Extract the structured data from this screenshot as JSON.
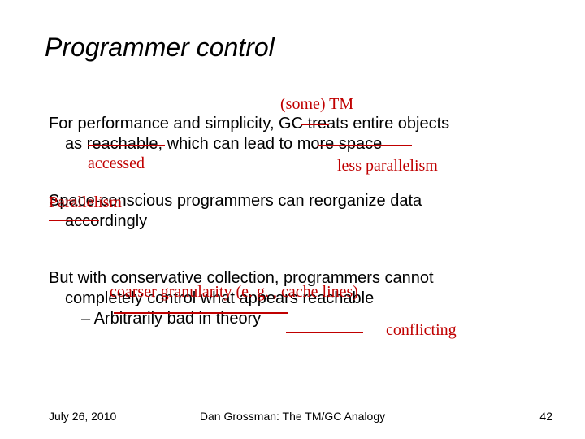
{
  "title": "Programmer control",
  "body": {
    "p1_line1": "For performance and simplicity, GC treats entire objects",
    "p1_line2": "as reachable, which can lead to more space",
    "p2_line1": "Space-conscious programmers can reorganize data",
    "p2_line2": "accordingly",
    "p3_line1": "But with conservative collection, programmers cannot",
    "p3_line2": "completely control what appears reachable",
    "p3_bullet": "– Arbitrarily bad in theory"
  },
  "annotations": {
    "some_tm": "(some) TM",
    "accessed": "accessed",
    "less_parallelism": "less parallelism",
    "parallelism": "Parallelism",
    "coarser": "coarser granularity (e. g. , cache lines)",
    "conflicting": "conflicting"
  },
  "footer": {
    "date": "July 26, 2010",
    "center": "Dan Grossman: The TM/GC Analogy",
    "page": "42"
  }
}
